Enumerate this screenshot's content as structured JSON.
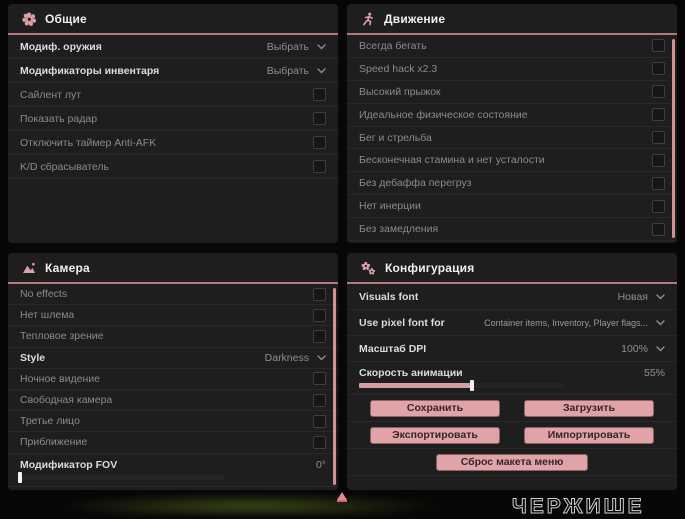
{
  "colors": {
    "accent": "#dba1a6",
    "panel_bg": "#1e1e1e",
    "header_line": "#b5797d",
    "button_bg": "#dfa3a8",
    "slider_fill": "#d89da2",
    "scrollbar": "#cf9397"
  },
  "general": {
    "title": "Общие",
    "icon": "flower-icon",
    "rows": [
      {
        "label": "Модиф. оружия",
        "type": "dropdown",
        "value": "Выбрать"
      },
      {
        "label": "Модификаторы инвентаря",
        "type": "dropdown",
        "value": "Выбрать"
      },
      {
        "label": "Сайлент лут",
        "type": "checkbox",
        "checked": false
      },
      {
        "label": "Показать радар",
        "type": "checkbox",
        "checked": false
      },
      {
        "label": "Отключить таймер Anti-AFK",
        "type": "checkbox",
        "checked": false
      },
      {
        "label": "K/D сбрасыватель",
        "type": "checkbox",
        "checked": false
      }
    ]
  },
  "movement": {
    "title": "Движение",
    "icon": "runner-icon",
    "rows": [
      {
        "label": "Всегда бегать",
        "type": "checkbox",
        "checked": false
      },
      {
        "label": "Speed hack x2.3",
        "type": "checkbox",
        "checked": false
      },
      {
        "label": "Высокий прыжок",
        "type": "checkbox",
        "checked": false
      },
      {
        "label": "Идеальное физическое состояние",
        "type": "checkbox",
        "checked": false
      },
      {
        "label": "Бег и стрельба",
        "type": "checkbox",
        "checked": false
      },
      {
        "label": "Бесконечная стамина и нет усталости",
        "type": "checkbox",
        "checked": false
      },
      {
        "label": "Без дебаффа перегруз",
        "type": "checkbox",
        "checked": false
      },
      {
        "label": "Нет инерции",
        "type": "checkbox",
        "checked": false
      },
      {
        "label": "Без замедления",
        "type": "checkbox",
        "checked": false
      }
    ]
  },
  "camera": {
    "title": "Камера",
    "icon": "image-icon",
    "rows": [
      {
        "label": "No effects",
        "type": "checkbox",
        "checked": false
      },
      {
        "label": "Нет шлема",
        "type": "checkbox",
        "checked": false
      },
      {
        "label": "Тепловое зрение",
        "type": "checkbox",
        "checked": false
      },
      {
        "label": "Style",
        "type": "dropdown",
        "value": "Darkness"
      },
      {
        "label": "Ночное видение",
        "type": "checkbox",
        "checked": false
      },
      {
        "label": "Свободная камера",
        "type": "checkbox",
        "checked": false
      },
      {
        "label": "Третье лицо",
        "type": "checkbox",
        "checked": false
      },
      {
        "label": "Приближение",
        "type": "checkbox",
        "checked": false
      }
    ],
    "fov": {
      "label": "Модификатор FOV",
      "value": "0°",
      "percent": 0
    }
  },
  "config": {
    "title": "Конфигурация",
    "icon": "gears-icon",
    "rows": [
      {
        "label": "Visuals font",
        "type": "dropdown",
        "value": "Новая"
      },
      {
        "label": "Use pixel font for",
        "type": "dropdown",
        "value": "Container items, Inventory, Player flags..."
      },
      {
        "label": "Масштаб DPI",
        "type": "dropdown",
        "value": "100%"
      }
    ],
    "anim": {
      "label": "Скорость анимации",
      "value": "55%",
      "percent": 55
    },
    "buttons": {
      "save": "Сохранить",
      "load": "Загрузить",
      "export": "Экспортировать",
      "import": "Импортировать",
      "reset": "Сброс макета меню"
    }
  },
  "background": {
    "watermark": "ЧЕРЖИШЕ"
  }
}
